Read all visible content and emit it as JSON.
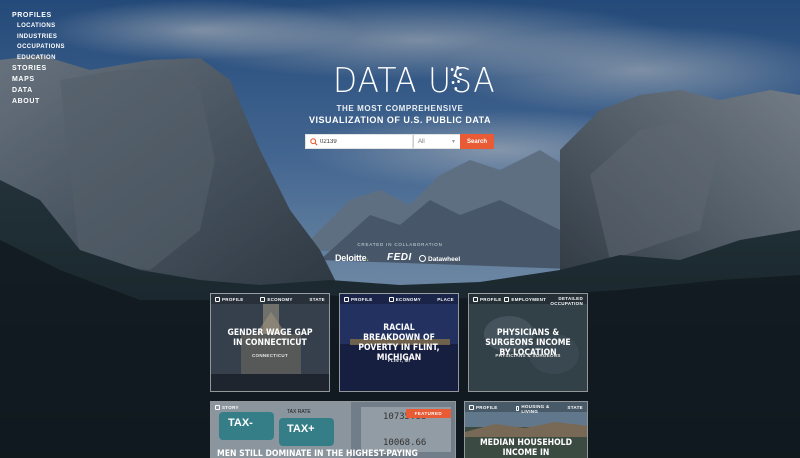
{
  "nav": {
    "profiles": "PROFILES",
    "locations": "LOCATIONS",
    "industries": "INDUSTRIES",
    "occupations": "OCCUPATIONS",
    "education": "EDUCATION",
    "stories": "STORIES",
    "maps": "MAPS",
    "data": "DATA",
    "about": "ABOUT"
  },
  "hero": {
    "logo": "DATA USA",
    "tagline_line1": "THE MOST COMPREHENSIVE",
    "tagline_line2": "VISUALIZATION OF U.S. PUBLIC DATA"
  },
  "search": {
    "value": "02139",
    "filter": "All",
    "button": "Search"
  },
  "collab": {
    "label": "CREATED IN COLLABORATION",
    "partner1": "Deloitte",
    "partner2": "FEDI",
    "partner3": "Datawheel"
  },
  "tiles": [
    {
      "type": "PROFILE",
      "topic": "ECONOMY",
      "scope": "STATE",
      "title": "GENDER WAGE GAP IN CONNECTICUT",
      "subtitle": "CONNECTICUT"
    },
    {
      "type": "PROFILE",
      "topic": "ECONOMY",
      "scope": "PLACE",
      "title": "RACIAL BREAKDOWN OF POVERTY IN FLINT, MICHIGAN",
      "subtitle": "FLINT, MI"
    },
    {
      "type": "PROFILE",
      "topic": "EMPLOYMENT",
      "scope": "DETAILED OCCUPATION",
      "title": "PHYSICIANS & SURGEONS INCOME BY LOCATION",
      "subtitle": "PHYSICIANS & SURGEONS"
    },
    {
      "type": "STORY",
      "badge": "FEATURED",
      "title": "MEN STILL DOMINATE IN THE HIGHEST-PAYING",
      "img_text": {
        "key1": "TAX-",
        "key2": "TAX+",
        "label": "TAX RATE",
        "num1": "10735.88",
        "num2": "10068.66"
      }
    },
    {
      "type": "PROFILE",
      "topic": "HOUSING & LIVING",
      "scope": "STATE",
      "title": "MEDIAN HOUSEHOLD INCOME IN PENNSYLVANIA"
    }
  ],
  "colors": {
    "accent": "#e85b35",
    "sky": "#3f6ea8",
    "forest": "#1b2a30"
  }
}
